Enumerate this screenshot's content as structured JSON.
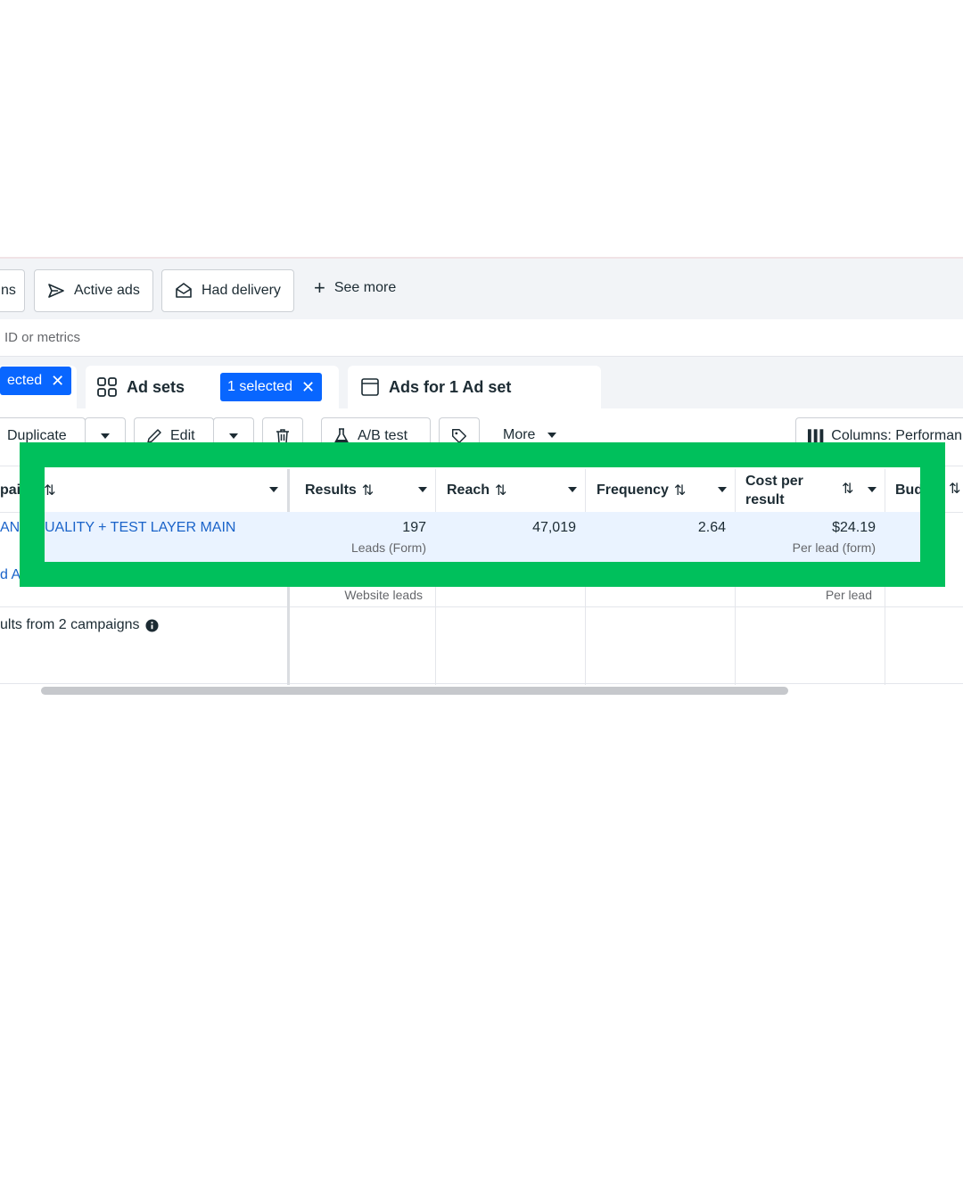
{
  "filters": {
    "cut_chip": "ns",
    "active_ads": "Active ads",
    "had_delivery": "Had delivery",
    "see_more": "See more"
  },
  "search": {
    "placeholder_fragment": "ID or metrics"
  },
  "tabs": {
    "campaigns_selected": "ected",
    "ad_sets": "Ad sets",
    "ad_sets_selected": "1 selected",
    "ads": "Ads for 1 Ad set"
  },
  "toolbar": {
    "duplicate": "Duplicate",
    "edit": "Edit",
    "ab_test": "A/B test",
    "more": "More",
    "columns": "Columns: Performan"
  },
  "table": {
    "headers": {
      "name": "pai",
      "results": "Results",
      "reach": "Reach",
      "frequency": "Frequency",
      "cost_per_result_1": "Cost per",
      "cost_per_result_2": "result",
      "budget": "Bud"
    },
    "rows": [
      {
        "name_left": "AN",
        "name": "UALITY + TEST LAYER MAIN",
        "results": "197",
        "results_sub": "Leads (Form)",
        "reach": "47,019",
        "frequency": "2.64",
        "cost": "$24.19",
        "cost_sub": "Per lead (form)"
      },
      {
        "name_left": "d A",
        "results_sub": "Website leads",
        "cost_sub": "Per lead"
      }
    ],
    "summary": "ults from 2 campaigns"
  },
  "colors": {
    "highlight": "#00c05c",
    "brand_blue": "#0866ff",
    "link_blue": "#1a63c9"
  }
}
